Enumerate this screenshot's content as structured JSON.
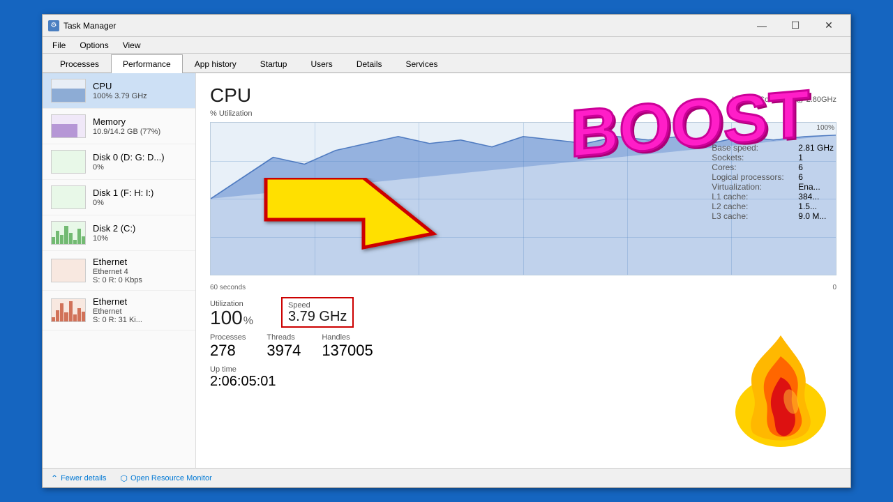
{
  "window": {
    "title": "Task Manager",
    "icon": "⚙"
  },
  "titlebar": {
    "minimize": "—",
    "maximize": "☐",
    "close": "✕"
  },
  "menu": {
    "items": [
      "File",
      "Options",
      "View"
    ]
  },
  "tabs": [
    {
      "id": "processes",
      "label": "Processes"
    },
    {
      "id": "performance",
      "label": "Performance",
      "active": true
    },
    {
      "id": "app-history",
      "label": "App history"
    },
    {
      "id": "startup",
      "label": "Startup"
    },
    {
      "id": "users",
      "label": "Users"
    },
    {
      "id": "details",
      "label": "Details"
    },
    {
      "id": "services",
      "label": "Services"
    }
  ],
  "sidebar": {
    "items": [
      {
        "id": "cpu",
        "name": "CPU",
        "detail": "100% 3.79 GHz",
        "active": true
      },
      {
        "id": "memory",
        "name": "Memory",
        "detail": "10.9/14.2 GB (77%)"
      },
      {
        "id": "disk0",
        "name": "Disk 0 (D: G: D...)",
        "detail": "0%"
      },
      {
        "id": "disk1",
        "name": "Disk 1 (F: H: I:)",
        "detail": "0%"
      },
      {
        "id": "disk2",
        "name": "Disk 2 (C:)",
        "detail": "10%"
      },
      {
        "id": "ethernet1",
        "name": "Ethernet",
        "detail2": "Ethernet 4",
        "detail": "S: 0  R: 0 Kbps"
      },
      {
        "id": "ethernet2",
        "name": "Ethernet",
        "detail2": "Ethernet",
        "detail": "S: 0  R: 31 Ki..."
      }
    ]
  },
  "main": {
    "cpu_title": "CPU",
    "cpu_subtitle": "% Utilization",
    "cpu_info": "Intel(R) Core™ i5- @ 2.80GHz",
    "percent_label": "100%",
    "graph_label_left": "60 seconds",
    "graph_label_right": "0",
    "utilization_label": "Utilization",
    "utilization_value": "100",
    "utilization_unit": "%",
    "speed_label": "Speed",
    "speed_value": "3.79 GHz",
    "processes_label": "Processes",
    "processes_value": "278",
    "threads_label": "Threads",
    "threads_value": "3974",
    "handles_label": "Handles",
    "handles_value": "137005",
    "uptime_label": "Up time",
    "uptime_value": "2:06:05:01",
    "base_speed_label": "Base speed:",
    "base_speed_value": "2.81 GHz",
    "sockets_label": "Sockets:",
    "sockets_value": "1",
    "cores_label": "Cores:",
    "cores_value": "6",
    "logical_label": "Logical processors:",
    "logical_value": "6",
    "virtualization_label": "Virtualization:",
    "virtualization_value": "Ena...",
    "l1_label": "L1 cache:",
    "l1_value": "384...",
    "l2_label": "L2 cache:",
    "l2_value": "1.5...",
    "l3_label": "L3 cache:",
    "l3_value": "9.0 M..."
  },
  "bottom": {
    "fewer_details": "Fewer details",
    "open_monitor": "Open Resource Monitor"
  },
  "overlay": {
    "boost_text": "BOOST"
  }
}
